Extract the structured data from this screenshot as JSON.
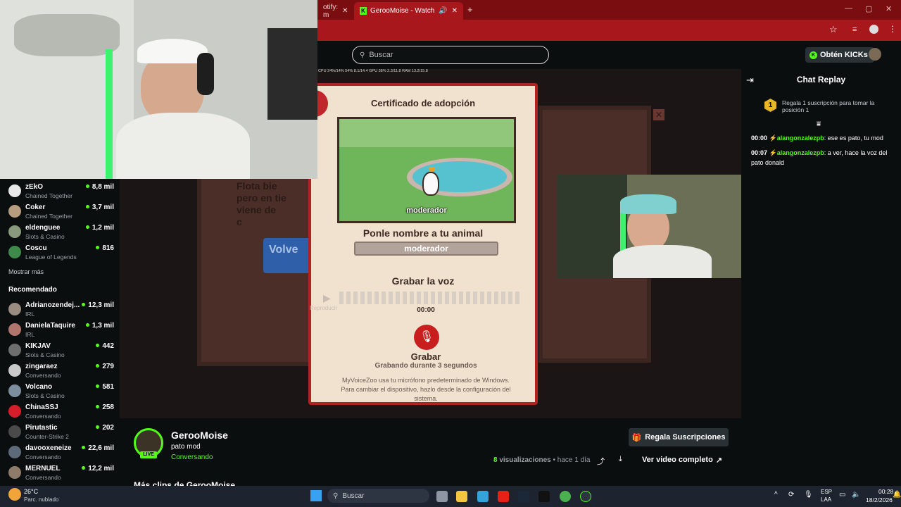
{
  "browser": {
    "tabs": [
      {
        "label": "otify: m"
      },
      {
        "label": "GerooMoise - Watch clips o"
      }
    ]
  },
  "header": {
    "search_placeholder": "Buscar",
    "get_kicks": "Obtén KICKs",
    "stats_overlay": "CPU 24%/14%   54%  8.1/14.4  GPU 38%   2.3/11.8   RAM 13.2/15.8"
  },
  "sidebar": {
    "following": [
      {
        "name": "zEkO",
        "category": "Chained Together",
        "viewers": "8,8 mil"
      },
      {
        "name": "Coker",
        "category": "Chained Together",
        "viewers": "3,7 mil"
      },
      {
        "name": "eldenguee",
        "category": "Slots & Casino",
        "viewers": "1,2 mil"
      },
      {
        "name": "Coscu",
        "category": "League of Legends",
        "viewers": "816"
      }
    ],
    "show_more": "Mostrar más",
    "recommended_title": "Recomendado",
    "recommended": [
      {
        "name": "Adrianozendej...",
        "category": "IRL",
        "viewers": "12,3 mil"
      },
      {
        "name": "DanielaTaquire",
        "category": "IRL",
        "viewers": "1,3 mil"
      },
      {
        "name": "KIKJAV",
        "category": "Slots & Casino",
        "viewers": "442"
      },
      {
        "name": "zingaraez",
        "category": "Conversando",
        "viewers": "279"
      },
      {
        "name": "Volcano",
        "category": "Slots & Casino",
        "viewers": "581"
      },
      {
        "name": "ChinaSSJ",
        "category": "Conversando",
        "viewers": "258"
      },
      {
        "name": "Pirutastic",
        "category": "Counter-Strike 2",
        "viewers": "202"
      },
      {
        "name": "davooxeneize",
        "category": "Conversando",
        "viewers": "22,6 mil"
      },
      {
        "name": "MERNUEL",
        "category": "Conversando",
        "viewers": "12,2 mil"
      }
    ]
  },
  "game": {
    "left_text": "Flota bie\npero en tie\nviene de\nc",
    "left_button": "Volve",
    "cert_title": "Certificado de adopción",
    "animal_name": "moderador",
    "name_prompt": "Ponle nombre a tu animal",
    "name_value": "moderador",
    "record_title": "Grabar la voz",
    "play_label": "Reproducir",
    "timer": "00:00",
    "record_button": "Grabar",
    "record_duration": "Grabando durante 3 segundos",
    "mic_note": "MyVoiceZoo usa tu micrófono predeterminado de Windows. Para cambiar el dispositivo, hazlo desde la configuración del sistema."
  },
  "chat": {
    "title": "Chat Replay",
    "gift_prompt": "Regala 1 suscripción para tomar la posición 1",
    "gift_rank": "1",
    "messages": [
      {
        "time": "00:00",
        "user": "alangonzalezpb",
        "text": "ese es pato, tu mod"
      },
      {
        "time": "00:07",
        "user": "alangonzalezpb",
        "text": "a ver, hace la voz del pato donald"
      }
    ]
  },
  "clip": {
    "channel": "GerooMoise",
    "title": "pato mod",
    "category": "Conversando",
    "live_badge": "LIVE",
    "gift_subs": "Regala Suscripciones",
    "views_count": "8",
    "views_label": "visualizaciones",
    "age": "• hace 1 día",
    "full_video": "Ver video completo",
    "more_clips": "Más clips de GerooMoise"
  },
  "taskbar": {
    "weather_temp": "26°C",
    "weather_desc": "Parc. nublado",
    "search": "Buscar",
    "lang": "ESP",
    "region": "LAA",
    "time": "00:28",
    "date": "18/2/2026"
  },
  "colors": {
    "kick_green": "#53fc18",
    "chrome_red": "#a8171b",
    "dark_bg": "#0b0e0f"
  }
}
